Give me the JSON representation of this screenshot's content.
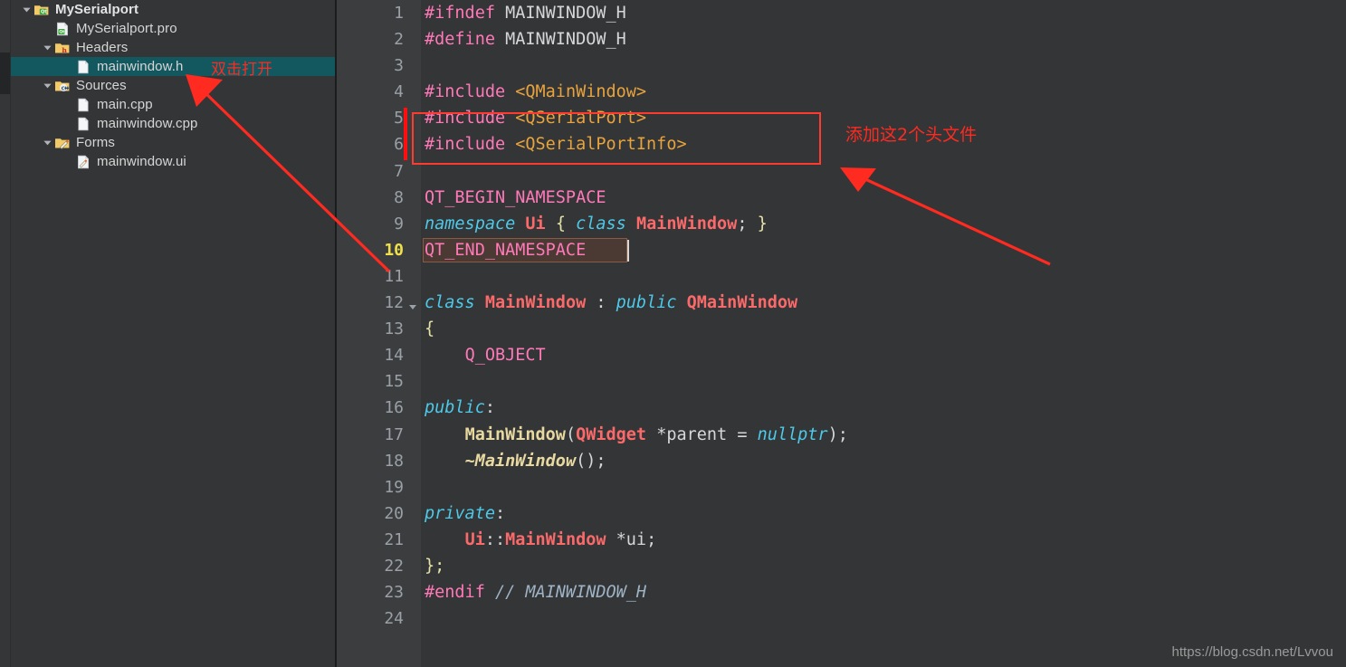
{
  "colors": {
    "sidebar_bg": "#333537",
    "editor_bg": "#333537",
    "gutter_bg": "#3b3d3f",
    "selection": "#13575f",
    "annotation_red": "#ff3b30",
    "current_line_number": "#f0e14a",
    "change_marker": "#ff0f0f",
    "right_pane_bg": "#2e2f30"
  },
  "sidebar": {
    "name": "project-tree",
    "items": [
      {
        "label": "MySerialport",
        "indent": 0,
        "icon": "qt-folder-icon",
        "expanded": true,
        "bold": true,
        "selected": false,
        "has_arrow": true
      },
      {
        "label": "MySerialport.pro",
        "indent": 1,
        "icon": "qt-profile-file-icon",
        "expanded": null,
        "bold": false,
        "selected": false,
        "has_arrow": false
      },
      {
        "label": "Headers",
        "indent": 1,
        "icon": "headers-folder-icon",
        "expanded": true,
        "bold": false,
        "selected": false,
        "has_arrow": true
      },
      {
        "label": "mainwindow.h",
        "indent": 2,
        "icon": "file-icon",
        "expanded": null,
        "bold": false,
        "selected": true,
        "has_arrow": false
      },
      {
        "label": "Sources",
        "indent": 1,
        "icon": "sources-folder-icon",
        "expanded": true,
        "bold": false,
        "selected": false,
        "has_arrow": true
      },
      {
        "label": "main.cpp",
        "indent": 2,
        "icon": "file-icon",
        "expanded": null,
        "bold": false,
        "selected": false,
        "has_arrow": false
      },
      {
        "label": "mainwindow.cpp",
        "indent": 2,
        "icon": "file-icon",
        "expanded": null,
        "bold": false,
        "selected": false,
        "has_arrow": false
      },
      {
        "label": "Forms",
        "indent": 1,
        "icon": "forms-folder-icon",
        "expanded": true,
        "bold": false,
        "selected": false,
        "has_arrow": true
      },
      {
        "label": "mainwindow.ui",
        "indent": 2,
        "icon": "ui-file-icon",
        "expanded": null,
        "bold": false,
        "selected": false,
        "has_arrow": false
      }
    ]
  },
  "editor": {
    "name": "code-editor",
    "filename": "mainwindow.h",
    "current_line": 10,
    "total_lines": 24,
    "line_numbers": [
      "1",
      "2",
      "3",
      "4",
      "5",
      "6",
      "7",
      "8",
      "9",
      "10",
      "11",
      "12",
      "13",
      "14",
      "15",
      "16",
      "17",
      "18",
      "19",
      "20",
      "21",
      "22",
      "23",
      "24"
    ],
    "changed_lines": [
      5,
      6
    ],
    "fold_lines": [
      12
    ],
    "lines": [
      {
        "n": 1,
        "text": "#ifndef MAINWINDOW_H"
      },
      {
        "n": 2,
        "text": "#define MAINWINDOW_H"
      },
      {
        "n": 3,
        "text": ""
      },
      {
        "n": 4,
        "text": "#include <QMainWindow>"
      },
      {
        "n": 5,
        "text": "#include <QSerialPort>"
      },
      {
        "n": 6,
        "text": "#include <QSerialPortInfo>"
      },
      {
        "n": 7,
        "text": ""
      },
      {
        "n": 8,
        "text": "QT_BEGIN_NAMESPACE"
      },
      {
        "n": 9,
        "text": "namespace Ui { class MainWindow; }"
      },
      {
        "n": 10,
        "text": "QT_END_NAMESPACE"
      },
      {
        "n": 11,
        "text": ""
      },
      {
        "n": 12,
        "text": "class MainWindow : public QMainWindow"
      },
      {
        "n": 13,
        "text": "{"
      },
      {
        "n": 14,
        "text": "    Q_OBJECT"
      },
      {
        "n": 15,
        "text": ""
      },
      {
        "n": 16,
        "text": "public:"
      },
      {
        "n": 17,
        "text": "    MainWindow(QWidget *parent = nullptr);"
      },
      {
        "n": 18,
        "text": "    ~MainWindow();"
      },
      {
        "n": 19,
        "text": ""
      },
      {
        "n": 20,
        "text": "private:"
      },
      {
        "n": 21,
        "text": "    Ui::MainWindow *ui;"
      },
      {
        "n": 22,
        "text": "};"
      },
      {
        "n": 23,
        "text": "#endif // MAINWINDOW_H"
      },
      {
        "n": 24,
        "text": ""
      }
    ]
  },
  "annotations": {
    "tree_note": "双击打开",
    "code_note": "添加这2个头文件"
  },
  "watermark": {
    "text": "https://blog.csdn.net/Lvvou"
  }
}
